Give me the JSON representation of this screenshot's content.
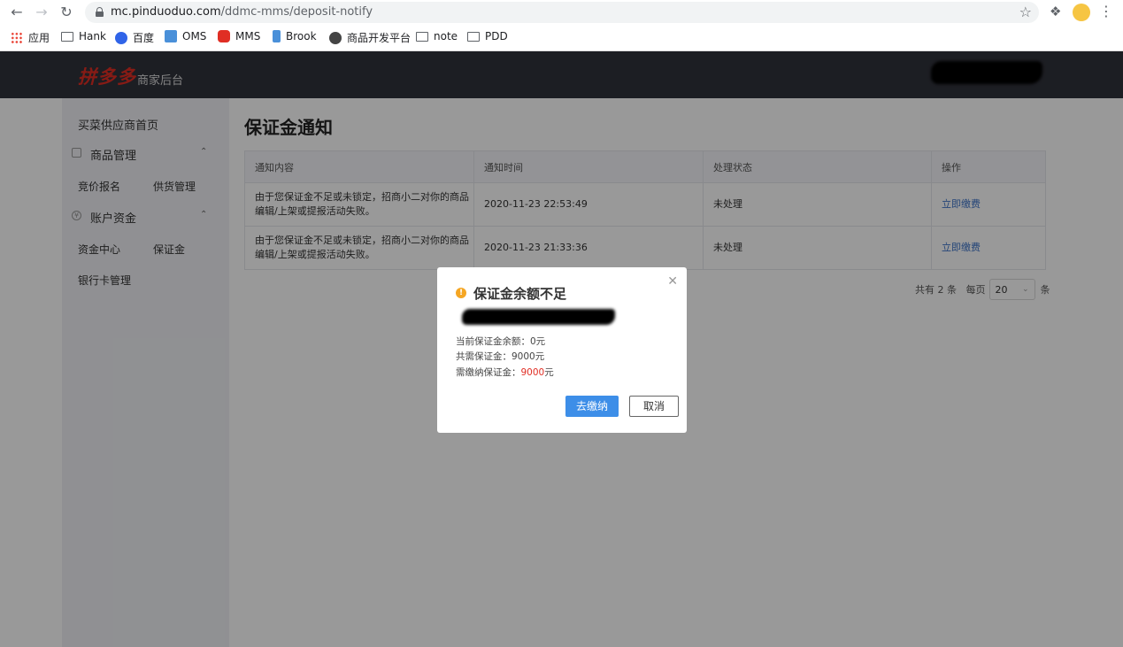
{
  "browser": {
    "url_host": "mc.pinduoduo.com",
    "url_path": "/ddmc-mms/deposit-notify",
    "bookmarks": [
      "应用",
      "Hank",
      "百度",
      "OMS",
      "MMS",
      "Brook",
      "商品开发平台",
      "note",
      "PDD"
    ]
  },
  "header": {
    "logo": "拼多多",
    "logo_sub": "商家后台"
  },
  "sidebar": {
    "home": "买菜供应商首页",
    "group1": {
      "label": "商品管理",
      "items": [
        "竞价报名",
        "供货管理"
      ]
    },
    "group2": {
      "icon_char": "¥",
      "label": "账户资金",
      "items": [
        "资金中心",
        "保证金",
        "银行卡管理"
      ]
    }
  },
  "page": {
    "title": "保证金通知",
    "columns": [
      "通知内容",
      "通知时间",
      "处理状态",
      "操作"
    ],
    "rows": [
      {
        "content": "由于您保证金不足或未锁定，招商小二对你的商品编辑/上架或提报活动失败。",
        "time": "2020-11-23 22:53:49",
        "status": "未处理",
        "action": "立即缴费"
      },
      {
        "content": "由于您保证金不足或未锁定，招商小二对你的商品编辑/上架或提报活动失败。",
        "time": "2020-11-23 21:33:36",
        "status": "未处理",
        "action": "立即缴费"
      }
    ],
    "pager": {
      "total_prefix": "共有",
      "total": "2",
      "total_suffix": "条",
      "per_page_label": "每页",
      "per_page": "20",
      "per_page_suffix": "条"
    }
  },
  "modal": {
    "warn_icon": "!",
    "title": "保证金余额不足",
    "line1": "当前保证金余额：0元",
    "line2": "共需保证金：9000元",
    "line3_label": "需缴纳保证金：",
    "line3_value": "9000",
    "line3_unit": "元",
    "confirm": "去缴纳",
    "cancel": "取消"
  },
  "colors": {
    "header_bg": "#30323b",
    "brand_red": "#e02e24",
    "primary_blue": "#3d8ee8",
    "link_blue": "#3d73c8",
    "warning": "#f5a623"
  }
}
